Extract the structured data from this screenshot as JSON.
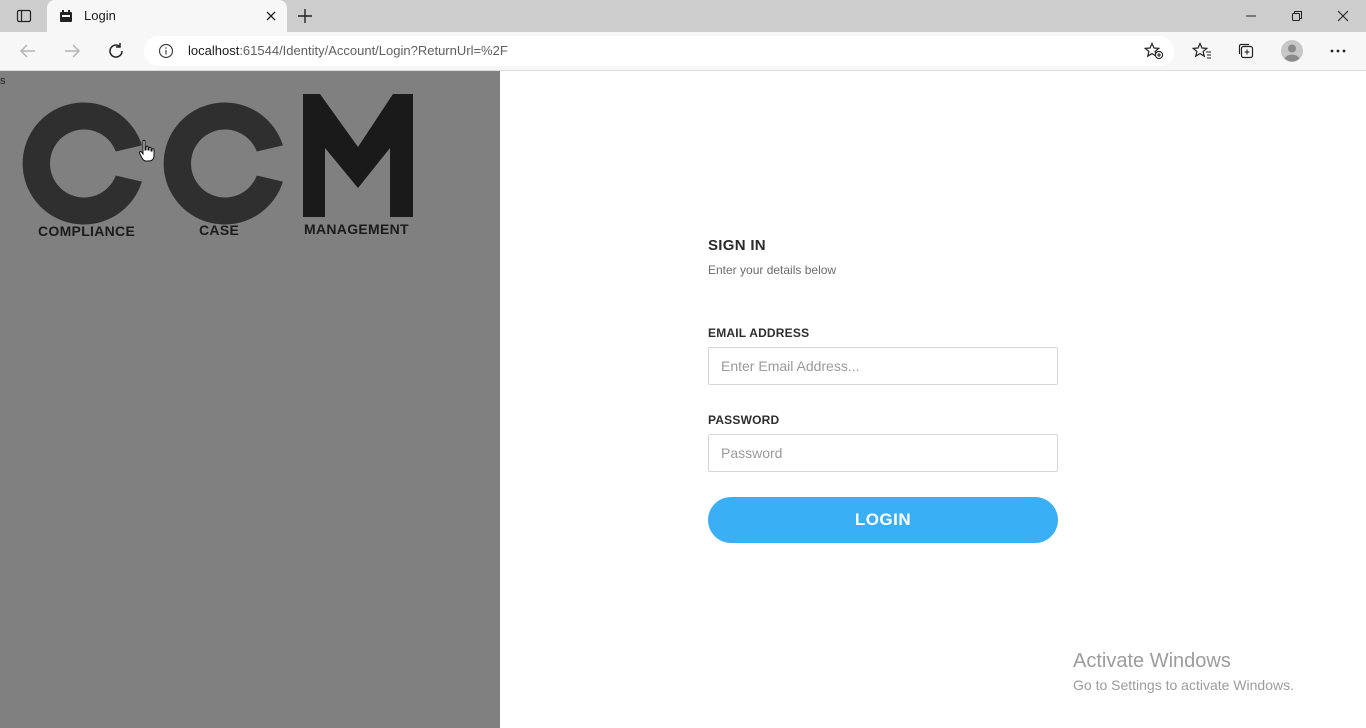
{
  "browser": {
    "tab": {
      "title": "Login"
    },
    "address_bar": {
      "url_host": "localhost",
      "url_path": ":61544/Identity/Account/Login?ReturnUrl=%2F"
    }
  },
  "page": {
    "stray_text": "s",
    "logo": {
      "words": [
        "COMPLIANCE",
        "CASE",
        "MANAGEMENT"
      ],
      "color": "#2f2f2f"
    },
    "signin": {
      "title": "SIGN IN",
      "subtitle": "Enter your details below",
      "email_label": "EMAIL ADDRESS",
      "email_placeholder": "Enter Email Address...",
      "password_label": "PASSWORD",
      "password_placeholder": "Password",
      "login_label": "LOGIN",
      "accent_color": "#3aaff5"
    },
    "left_panel_color": "#808080"
  },
  "watermark": {
    "title": "Activate Windows",
    "subtitle": "Go to Settings to activate Windows."
  }
}
